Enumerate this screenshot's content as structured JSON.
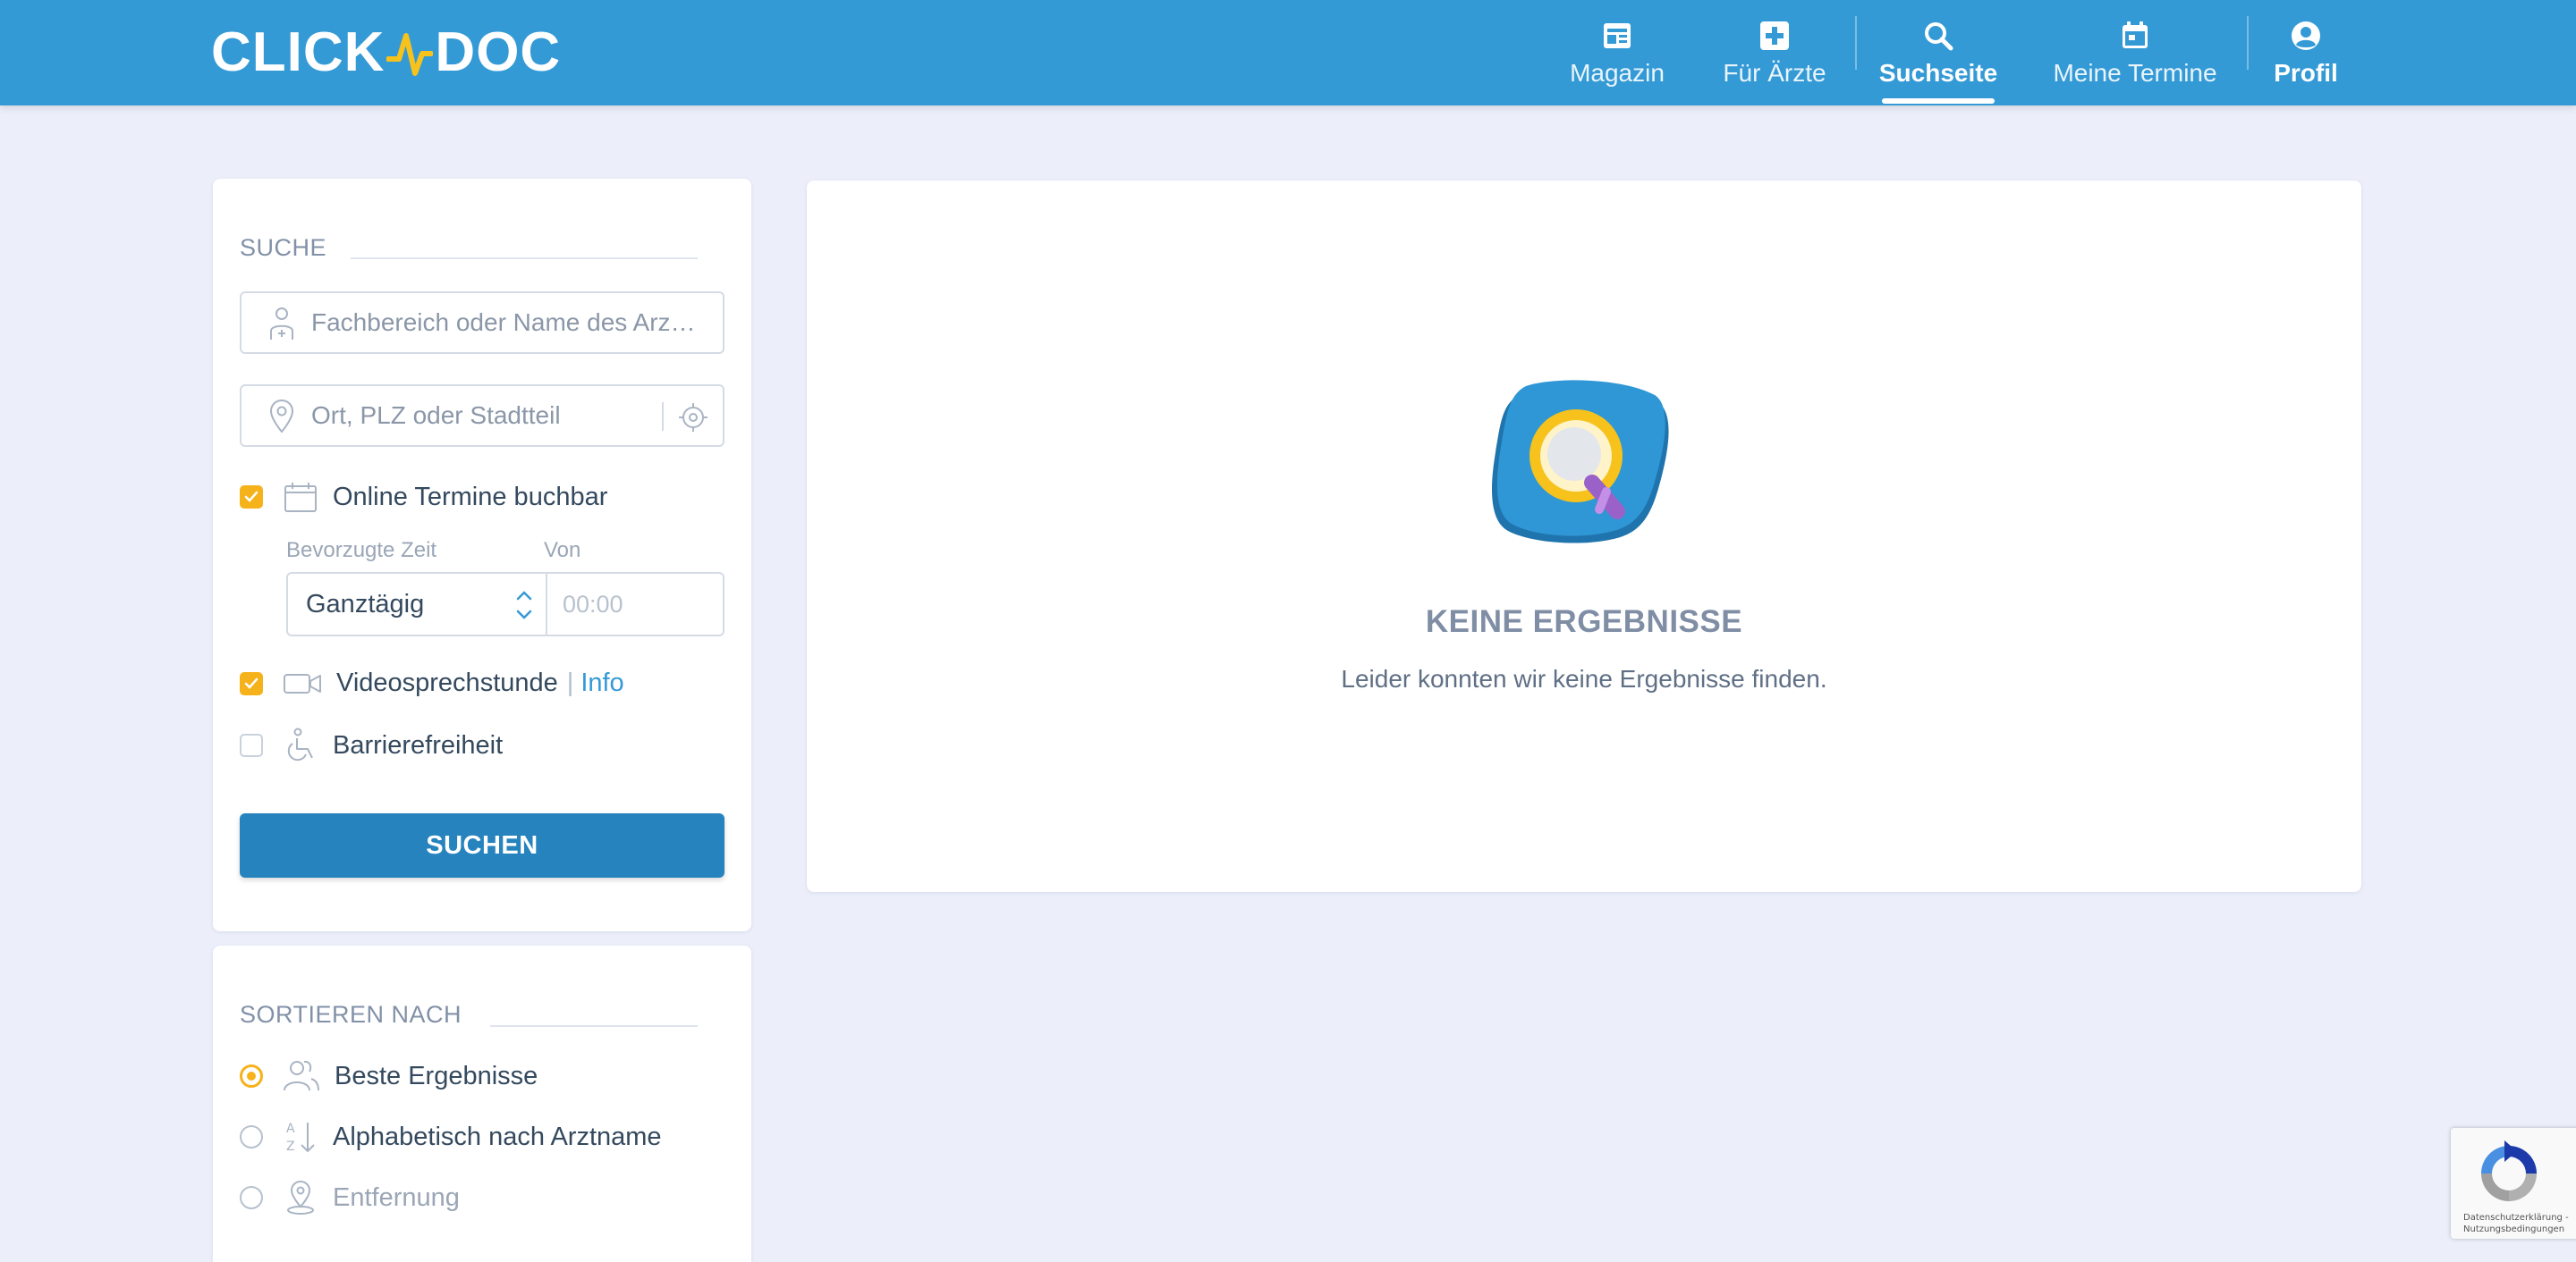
{
  "header": {
    "logo_left": "CLICK",
    "logo_right": "DOC",
    "nav": [
      {
        "label": "Magazin",
        "icon": "newspaper-icon"
      },
      {
        "label": "Für Ärzte",
        "icon": "medical-cross-icon"
      },
      {
        "label": "Suchseite",
        "icon": "search-icon",
        "active": true
      },
      {
        "label": "Meine Termine",
        "icon": "calendar-icon"
      },
      {
        "label": "Profil",
        "icon": "user-circle-icon"
      }
    ]
  },
  "search": {
    "title": "SUCHE",
    "specialty_placeholder": "Fachbereich oder Name des Arz…",
    "location_placeholder": "Ort, PLZ oder Stadtteil",
    "online_label": "Online Termine buchbar",
    "online_checked": true,
    "preferred_time_label": "Bevorzugte Zeit",
    "from_label": "Von",
    "time_select_value": "Ganztägig",
    "time_from_placeholder": "00:00",
    "video_label": "Videosprechstunde",
    "video_checked": true,
    "info_sep": "|",
    "info_link": "Info",
    "accessibility_label": "Barrierefreiheit",
    "accessibility_checked": false,
    "submit_label": "SUCHEN"
  },
  "sort": {
    "title": "SORTIEREN NACH",
    "options": [
      {
        "label": "Beste Ergebnisse",
        "selected": true
      },
      {
        "label": "Alphabetisch nach Arztname",
        "selected": false
      },
      {
        "label": "Entfernung",
        "selected": false,
        "disabled": true
      }
    ]
  },
  "results": {
    "title": "KEINE ERGEBNISSE",
    "text": "Leider konnten wir keine Ergebnisse finden."
  },
  "recaptcha": {
    "line1": "Datenschutzerklärung -",
    "line2": "Nutzungsbedingungen"
  },
  "colors": {
    "header": "#349ad6",
    "accent": "#f6b21b",
    "button": "#2683be",
    "background": "#eceffa"
  }
}
